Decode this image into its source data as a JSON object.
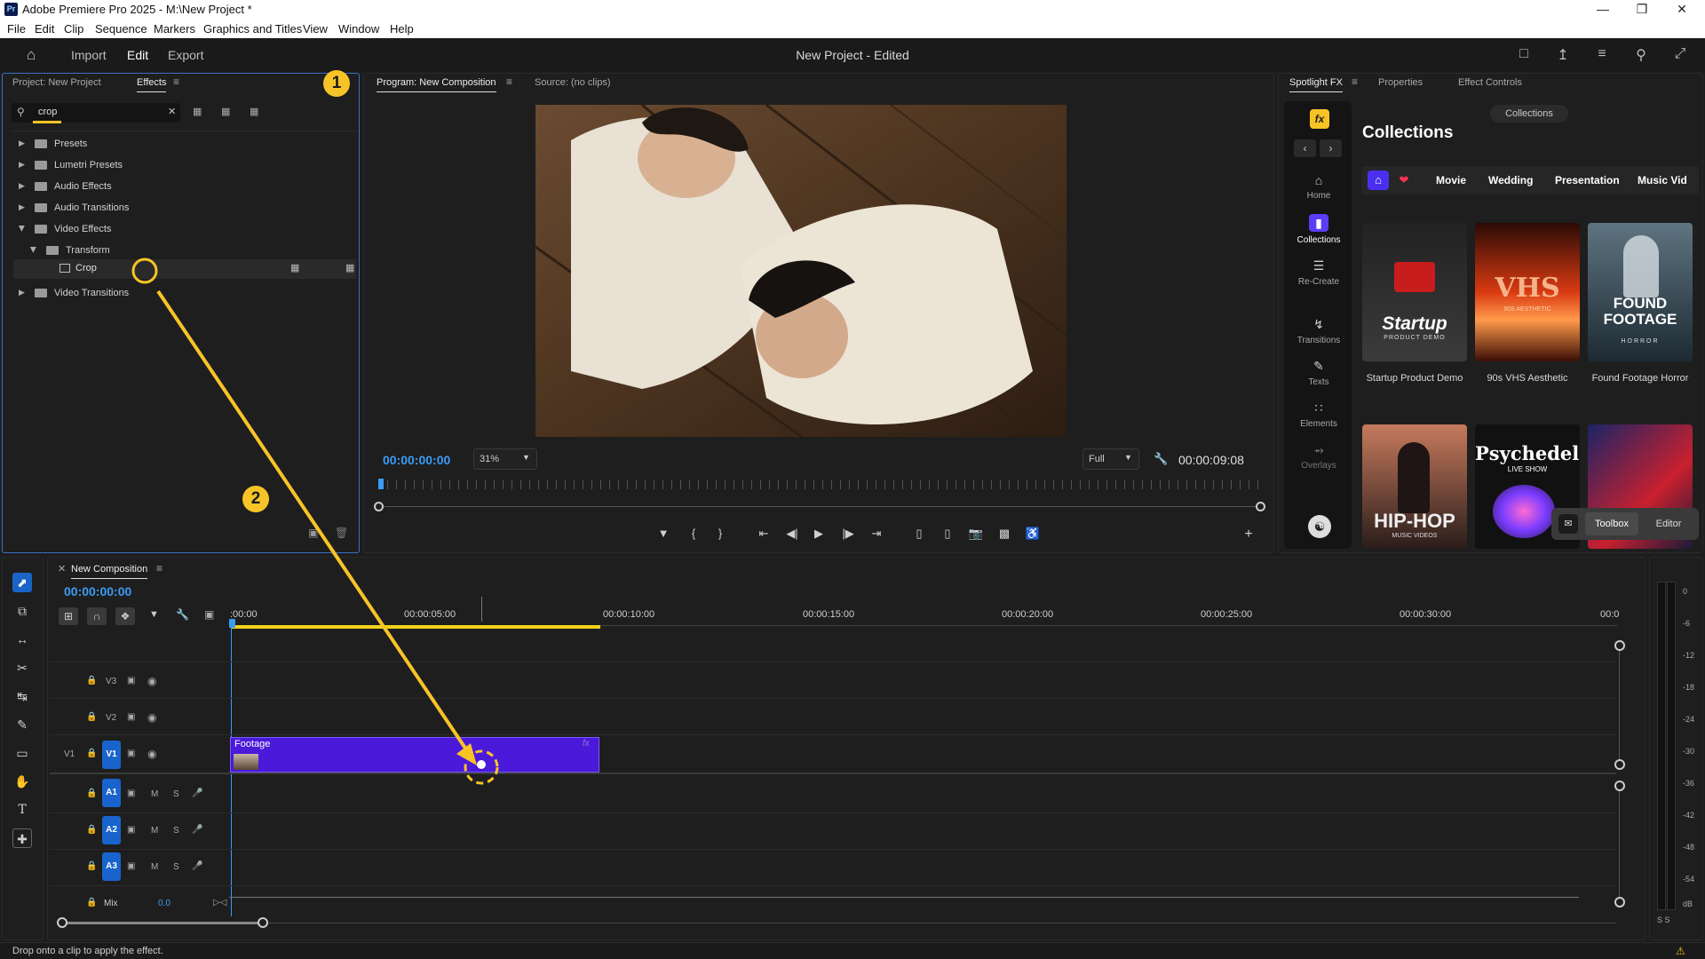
{
  "window": {
    "title": "Adobe Premiere Pro 2025 - M:\\New Project *",
    "app_icon": "Pr"
  },
  "menu": [
    "File",
    "Edit",
    "Clip",
    "Sequence",
    "Markers",
    "Graphics and Titles",
    "View",
    "Window",
    "Help"
  ],
  "header": {
    "import": "Import",
    "edit": "Edit",
    "export": "Export",
    "project_title": "New Project - Edited"
  },
  "project_panel": {
    "tab_project": "Project: New Project",
    "tab_effects": "Effects",
    "search_value": "crop",
    "tree": [
      {
        "label": "Presets",
        "expanded": false
      },
      {
        "label": "Lumetri Presets",
        "expanded": false
      },
      {
        "label": "Audio Effects",
        "expanded": false
      },
      {
        "label": "Audio Transitions",
        "expanded": false
      },
      {
        "label": "Video Effects",
        "expanded": true
      },
      {
        "label": "Transform",
        "expanded": true
      },
      {
        "label": "Crop",
        "selected": true
      },
      {
        "label": "Video Transitions",
        "expanded": false
      }
    ]
  },
  "annotations": {
    "step1": "1",
    "step2": "2",
    "accent": "#f7c427"
  },
  "program_monitor": {
    "tab_program": "Program: New Composition",
    "tab_source": "Source: (no clips)",
    "current_time": "00:00:00:00",
    "zoom": "31%",
    "quality": "Full",
    "duration": "00:00:09:08"
  },
  "spotlight": {
    "tab_spotlight": "Spotlight FX",
    "tab_properties": "Properties",
    "tab_effect_controls": "Effect Controls",
    "collections_pill": "Collections",
    "heading": "Collections",
    "nav": [
      "Home",
      "Collections",
      "Re-Create",
      "Transitions",
      "Texts",
      "Elements",
      "Overlays"
    ],
    "chips": [
      "Movie",
      "Wedding",
      "Presentation",
      "Music Vid"
    ],
    "cards": [
      {
        "label": "Startup Product Demo",
        "art": "Startup",
        "sub": "PRODUCT DEMO"
      },
      {
        "label": "90s VHS Aesthetic",
        "art": "VHS",
        "sub": "90S AESTHETIC"
      },
      {
        "label": "Found Footage Horror",
        "art": "FOUND FOOTAGE",
        "sub": "HORROR"
      },
      {
        "art": "HIP-HOP",
        "sub": "MUSIC VIDEOS"
      },
      {
        "art": "Psychedelic",
        "sub": "LIVE SHOW"
      }
    ],
    "toolbox": "Toolbox",
    "editor": "Editor"
  },
  "timeline": {
    "sequence_name": "New Composition",
    "current_time": "00:00:00:00",
    "ruler": [
      ":00:00",
      "00:00:05:00",
      "00:00:10:00",
      "00:00:15:00",
      "00:00:20:00",
      "00:00:25:00",
      "00:00:30:00",
      "00:0"
    ],
    "tracks_video": [
      "V3",
      "V2",
      "V1"
    ],
    "tracks_audio": [
      "A1",
      "A2",
      "A3"
    ],
    "source_patch": "V1",
    "mix_label": "Mix",
    "mix_value": "0.0",
    "clip_name": "Footage",
    "clip_fx": "fx",
    "m": "M",
    "s": "S"
  },
  "meter_scale": [
    "0",
    "-6",
    "-12",
    "-18",
    "-24",
    "-30",
    "-36",
    "-42",
    "-48",
    "-54",
    "dB"
  ],
  "meter_footer": "S S",
  "status": {
    "text": "Drop onto a clip to apply the effect."
  }
}
